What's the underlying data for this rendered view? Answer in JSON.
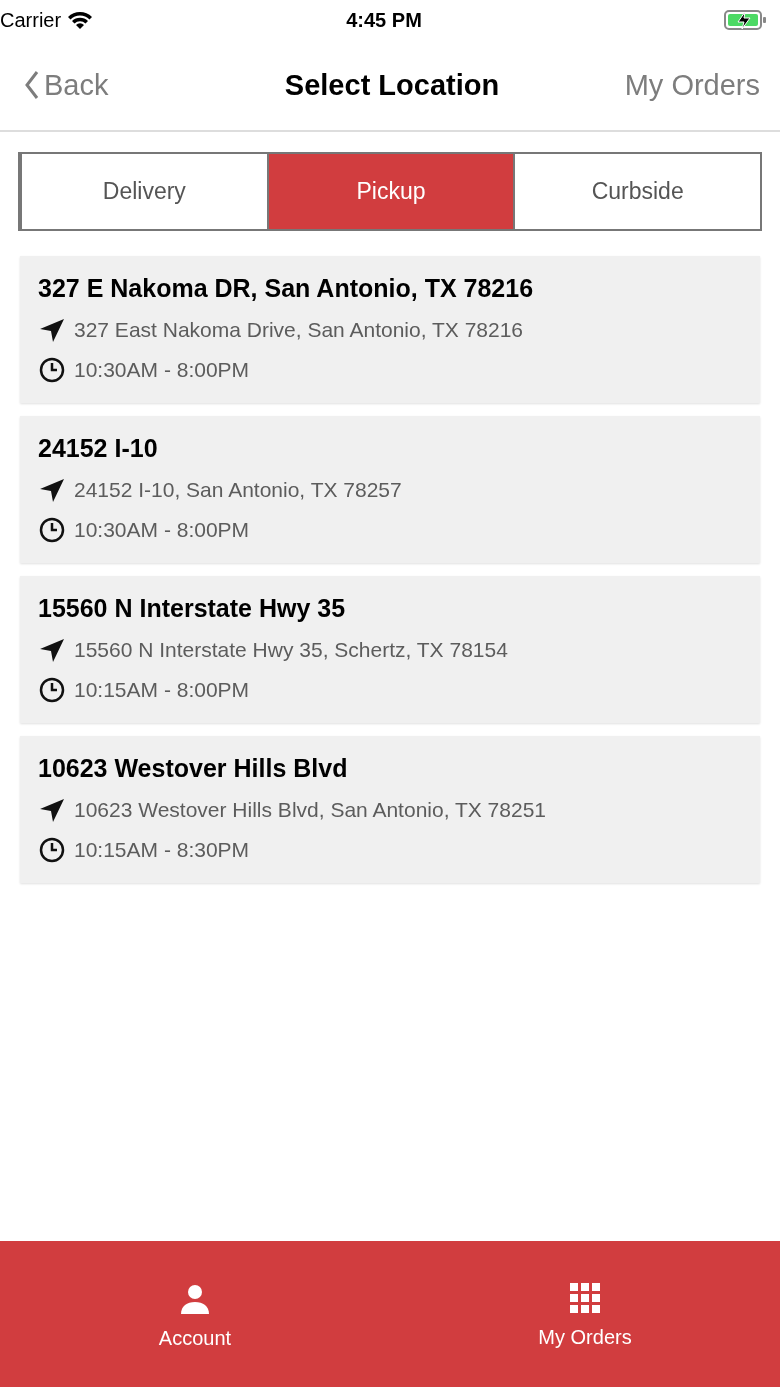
{
  "status_bar": {
    "carrier": "Carrier",
    "time": "4:45 PM",
    "battery_charging": true
  },
  "nav_bar": {
    "back": "Back",
    "title": "Select Location",
    "action": "My Orders"
  },
  "tabs": [
    {
      "label": "Delivery",
      "selected": false
    },
    {
      "label": "Pickup",
      "selected": true
    },
    {
      "label": "Curbside",
      "selected": false
    }
  ],
  "locations": [
    {
      "name": "327 E Nakoma DR, San Antonio, TX 78216",
      "address": "327 East Nakoma Drive, San Antonio, TX 78216",
      "hours": "10:30AM - 8:00PM"
    },
    {
      "name": "24152 I-10",
      "address": "24152 I-10, San Antonio, TX 78257",
      "hours": "10:30AM - 8:00PM"
    },
    {
      "name": "15560 N Interstate Hwy 35",
      "address": "15560 N Interstate Hwy 35, Schertz, TX 78154",
      "hours": "10:15AM - 8:00PM"
    },
    {
      "name": "10623 Westover Hills Blvd",
      "address": "10623 Westover Hills Blvd, San Antonio, TX 78251",
      "hours": "10:15AM - 8:30PM"
    }
  ],
  "tab_bar": [
    {
      "kind": "account",
      "label": "Account"
    },
    {
      "kind": "orders",
      "label": "My Orders"
    }
  ]
}
